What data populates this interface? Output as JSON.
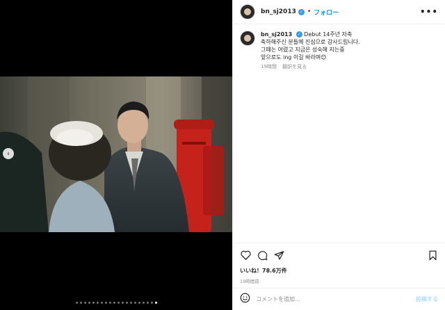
{
  "post": {
    "username": "bn_sj2013",
    "follow_label": "フォロー",
    "separator": "•",
    "more_label": "•••"
  },
  "caption": {
    "username": "bn_sj2013",
    "lines": [
      "Debut 14주년 자축",
      "축하해주신 분들께 진심으로 감사드립니다.",
      "그때는 어렸고 지금은 성숙해 지는중",
      "앞으로도 ing 이길 바라며😊"
    ],
    "time": "19時間",
    "translate_label": "翻訳を見る"
  },
  "media": {
    "prev_label": "‹",
    "dot_count": 20,
    "active_dot": 19
  },
  "stats": {
    "likes": "いいね！78.6万件",
    "time": "19時間前"
  },
  "comment": {
    "placeholder": "コメントを追加...",
    "post_label": "投稿する"
  },
  "icons": [
    "heart-icon",
    "comment-icon",
    "share-icon",
    "bookmark-icon",
    "emoji-icon",
    "verified-icon"
  ]
}
